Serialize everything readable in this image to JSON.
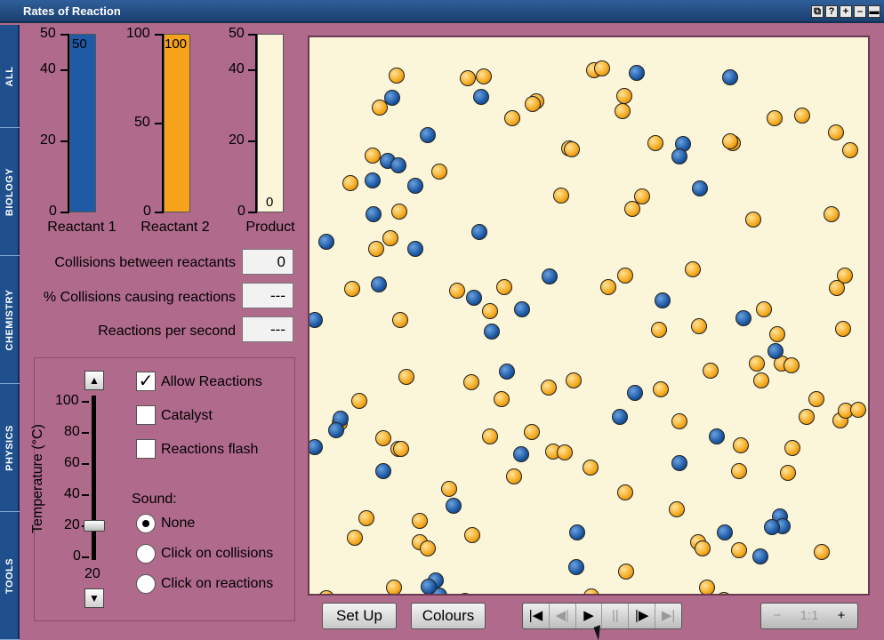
{
  "window": {
    "title": "Rates of Reaction",
    "buttons": [
      "restore-icon",
      "help-icon",
      "plus-icon",
      "minimize-icon",
      "close-icon"
    ],
    "button_glyphs": [
      "⧉",
      "?",
      "+",
      "–",
      "▬"
    ]
  },
  "side_tabs": [
    "ALL",
    "BIOLOGY",
    "CHEMISTRY",
    "PHYSICS",
    "TOOLS"
  ],
  "bars": {
    "reactant1": {
      "label": "Reactant 1",
      "value": "50",
      "max": "50",
      "ticks": [
        "50",
        "40",
        "20",
        "0"
      ],
      "fill_fraction": 1.0,
      "color": "#1f5aa6"
    },
    "reactant2": {
      "label": "Reactant 2",
      "value": "100",
      "max": "100",
      "ticks": [
        "100",
        "50",
        "0"
      ],
      "fill_fraction": 1.0,
      "color": "#f7a21b"
    },
    "product": {
      "label": "Product",
      "value": "0",
      "max": "50",
      "ticks": [
        "50",
        "40",
        "20",
        "0"
      ],
      "fill_fraction": 0.0,
      "color": "#fbf6d9"
    }
  },
  "stats": {
    "collisions_label": "Collisions between reactants",
    "collisions_value": "0",
    "pct_label": "% Collisions causing reactions",
    "pct_value": "---",
    "rate_label": "Reactions per second",
    "rate_value": "---"
  },
  "temperature": {
    "axis_label": "Temperature (°C)",
    "ticks": [
      "100",
      "80",
      "60",
      "40",
      "20",
      "0"
    ],
    "value": "20",
    "level_fraction": 0.2
  },
  "options": {
    "allow_reactions": {
      "label": "Allow Reactions",
      "checked": true,
      "mark": "✓"
    },
    "catalyst": {
      "label": "Catalyst",
      "checked": false
    },
    "reactions_flash": {
      "label": "Reactions flash",
      "checked": false
    }
  },
  "sound": {
    "label": "Sound:",
    "options": [
      "None",
      "Click on collisions",
      "Click on reactions"
    ],
    "selected": "None"
  },
  "buttons": {
    "setup": "Set Up",
    "colours": "Colours"
  },
  "transport": {
    "glyphs": [
      "|◀",
      "◀|",
      "▶",
      "||",
      "|▶",
      "▶|"
    ],
    "icons": [
      "skip-start-icon",
      "step-back-icon",
      "play-icon",
      "pause-icon",
      "step-forward-icon",
      "skip-end-icon"
    ]
  },
  "zoom": {
    "zoom_out": "−",
    "level": "1:1",
    "zoom_in": "+"
  },
  "colors": {
    "reactant1": "#1f5aa6",
    "reactant2": "#f7a21b",
    "background": "#b06a8c",
    "sim_bg": "#fbf6d9"
  }
}
